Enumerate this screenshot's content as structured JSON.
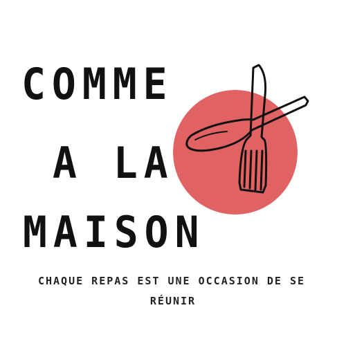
{
  "logo": {
    "title_lines": [
      "COMME",
      "A LA",
      "MAISON"
    ],
    "tagline_lines": [
      "CHAQUE REPAS EST UNE OCCASION DE SE",
      "RÉUNIR"
    ],
    "icons": [
      "spoon-icon",
      "fork-icon"
    ],
    "colors": {
      "background": "#ffffff",
      "circle": "#e06263",
      "text": "#111111",
      "icon_stroke": "#111111"
    }
  }
}
